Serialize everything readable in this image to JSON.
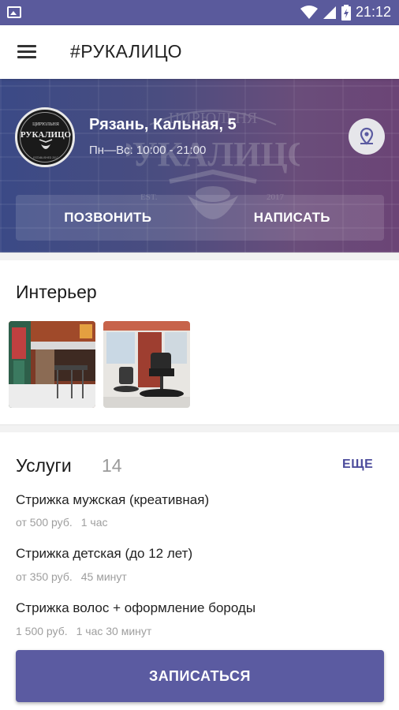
{
  "status_bar": {
    "time": "21:12",
    "icons": [
      "image-notification-icon",
      "wifi-icon",
      "signal-icon",
      "battery-charging-icon"
    ],
    "background": "#5a5a9c"
  },
  "app_bar": {
    "title": "#РУКАЛИЦО",
    "menu_icon": "hamburger-menu-icon"
  },
  "hero": {
    "address": "Рязань, Кальная, 5",
    "hours": "Пн—Вс: 10:00 - 21:00",
    "call_label": "ПОЗВОНИТЬ",
    "message_label": "НАПИСАТЬ",
    "map_icon": "map-pin-icon",
    "logo": {
      "top_text": "ЦИРЮЛЬНЯ",
      "main_text": "РУКАЛИЦО",
      "bottom_text": "ESTABLISHED 2017"
    },
    "watermark": {
      "top_text": "ЦИРЮЛЬНЯ",
      "main_text": "РУКАЛИЦО",
      "est": "EST.",
      "year": "2017"
    }
  },
  "interior": {
    "title": "Интерьер",
    "photos": [
      "bar-interior-photo",
      "barber-chair-photo"
    ]
  },
  "services": {
    "title": "Услуги",
    "count": "14",
    "more_label": "ЕЩЕ",
    "items": [
      {
        "name": "Стрижка мужская (креативная)",
        "price": "от 500 руб.",
        "duration": "1 час"
      },
      {
        "name": "Стрижка детская (до 12 лет)",
        "price": "от 350 руб.",
        "duration": "45 минут"
      },
      {
        "name": "Стрижка волос + оформление бороды",
        "price": "1 500 руб.",
        "duration": "1 час 30 минут"
      }
    ]
  },
  "book_button": {
    "label": "ЗАПИСАТЬСЯ"
  },
  "colors": {
    "accent": "#5b5ba1",
    "link": "#4b4b9b"
  }
}
